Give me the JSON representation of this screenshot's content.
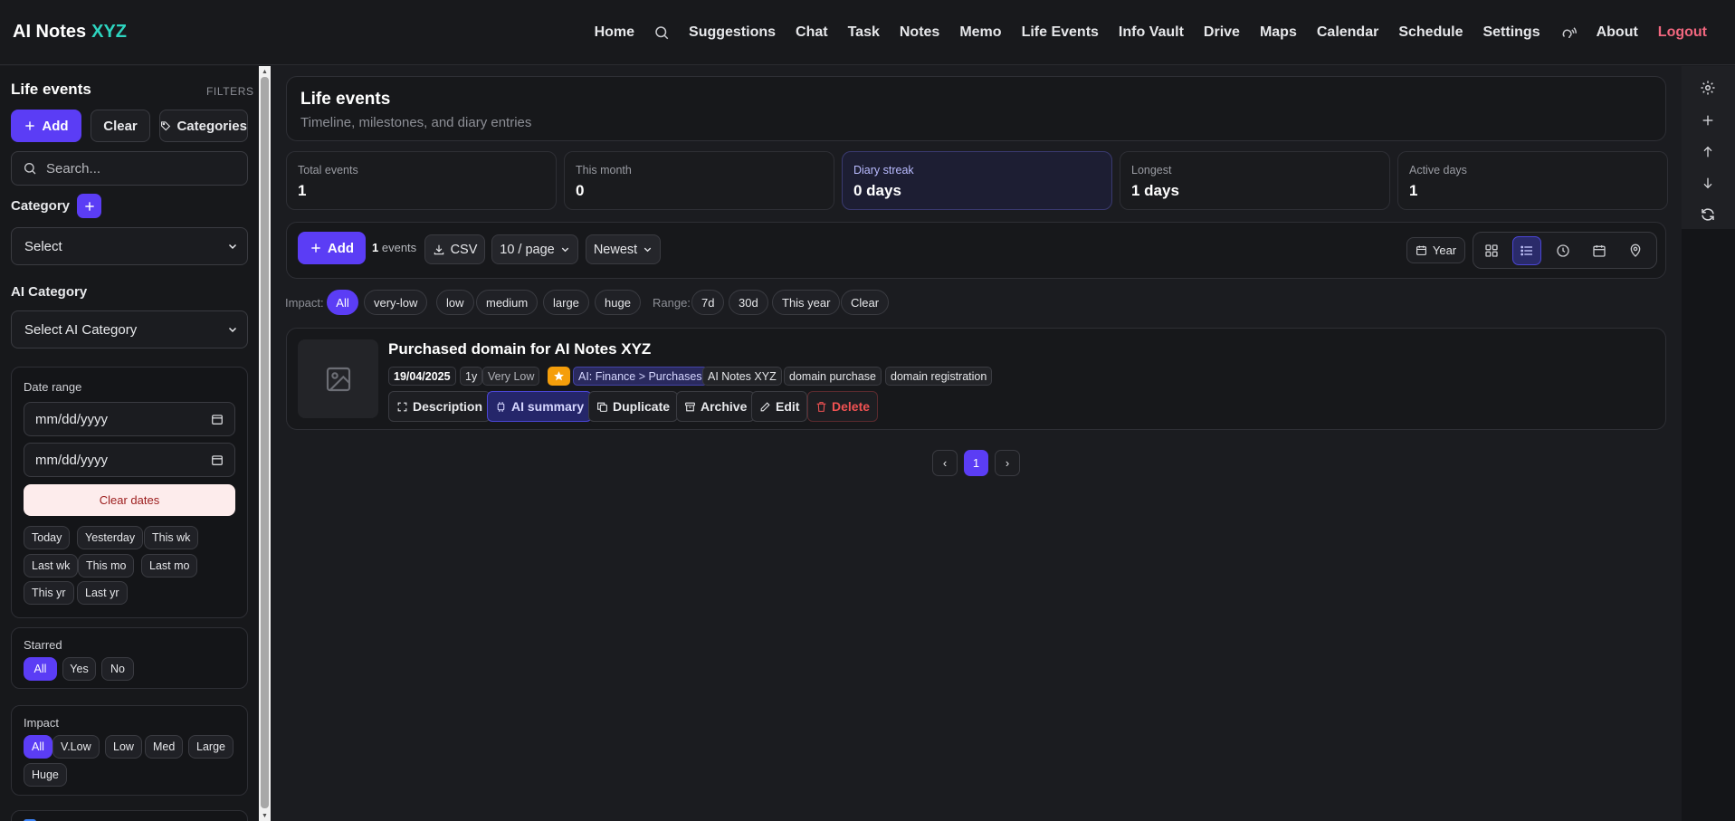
{
  "brand": {
    "name": "AI Notes",
    "accent": "XYZ"
  },
  "nav": {
    "items": [
      "Home",
      "Suggestions",
      "Chat",
      "Task",
      "Notes",
      "Memo",
      "Life Events",
      "Info Vault",
      "Drive",
      "Maps",
      "Calendar",
      "Schedule",
      "Settings",
      "About"
    ],
    "logout": "Logout"
  },
  "sidebar": {
    "title": "Life events",
    "filters_label": "FILTERS",
    "add_label": "Add",
    "clear_label": "Clear",
    "categories_label": "Categories",
    "search_placeholder": "Search...",
    "category_label": "Category",
    "category_select": "Select",
    "ai_category_label": "AI Category",
    "ai_category_select": "Select AI Category",
    "date_range": {
      "title": "Date range",
      "from_placeholder": "mm/dd/yyyy",
      "to_placeholder": "mm/dd/yyyy",
      "clear_label": "Clear dates",
      "quick": [
        "Today",
        "Yesterday",
        "This wk",
        "Last wk",
        "This mo",
        "Last mo",
        "This yr",
        "Last yr"
      ]
    },
    "starred": {
      "title": "Starred",
      "options": [
        "All",
        "Yes",
        "No"
      ],
      "selected": "All"
    },
    "impact": {
      "title": "Impact",
      "options": [
        "All",
        "V.Low",
        "Low",
        "Med",
        "Large",
        "Huge"
      ],
      "selected": "All"
    }
  },
  "header": {
    "title": "Life events",
    "subtitle": "Timeline, milestones, and diary entries"
  },
  "stats": [
    {
      "label": "Total events",
      "value": "1"
    },
    {
      "label": "This month",
      "value": "0"
    },
    {
      "label": "Diary streak",
      "value": "0 days"
    },
    {
      "label": "Longest",
      "value": "1 days"
    },
    {
      "label": "Active days",
      "value": "1"
    }
  ],
  "toolbar": {
    "add_label": "Add",
    "count": "1",
    "count_suffix": "events",
    "csv_label": "CSV",
    "per_page": "10 / page",
    "sort": "Newest",
    "year_label": "Year"
  },
  "filters": {
    "impact_label": "Impact:",
    "impact_options": [
      "All",
      "very-low",
      "low",
      "medium",
      "large",
      "huge"
    ],
    "range_label": "Range:",
    "range_options": [
      "7d",
      "30d",
      "This year",
      "Clear"
    ]
  },
  "event": {
    "title": "Purchased domain for AI Notes XYZ",
    "date": "19/04/2025",
    "age": "1y",
    "impact": "Very Low",
    "ai_category": "AI: Finance > Purchases",
    "tags": [
      "AI Notes XYZ",
      "domain purchase",
      "domain registration"
    ],
    "actions": {
      "description": "Description",
      "ai_summary": "AI summary",
      "duplicate": "Duplicate",
      "archive": "Archive",
      "edit": "Edit",
      "delete": "Delete"
    }
  },
  "pagination": {
    "prev": "‹",
    "current": "1",
    "next": "›"
  },
  "colors": {
    "accent": "#5b3df5",
    "brand_accent": "#2dd4bf",
    "logout": "#f0667e",
    "star": "#f59e0b",
    "danger": "#f05252"
  }
}
